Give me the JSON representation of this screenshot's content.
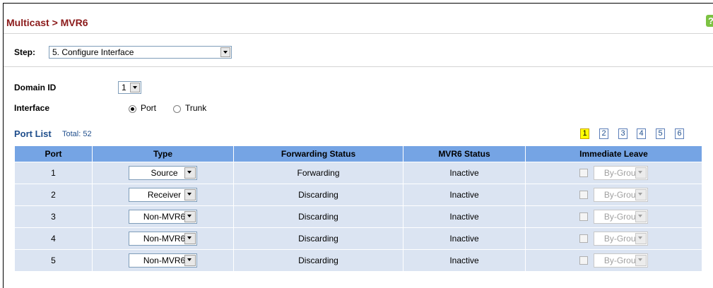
{
  "header": {
    "title": "Multicast > MVR6",
    "help_icon": "question-icon"
  },
  "step": {
    "label": "Step:",
    "value": "5. Configure Interface"
  },
  "form": {
    "domain_label": "Domain ID",
    "domain_value": "1",
    "interface_label": "Interface",
    "interface_options": [
      {
        "label": "Port",
        "checked": true
      },
      {
        "label": "Trunk",
        "checked": false
      }
    ]
  },
  "portlist": {
    "title": "Port List",
    "total": "Total: 52",
    "pages": [
      "1",
      "2",
      "3",
      "4",
      "5",
      "6"
    ],
    "active_page": "1"
  },
  "table": {
    "headers": [
      "Port",
      "Type",
      "Forwarding Status",
      "MVR6 Status",
      "Immediate Leave"
    ],
    "rows": [
      {
        "port": "1",
        "type": "Source",
        "forwarding": "Forwarding",
        "mvr6": "Inactive",
        "leave": "By-Group"
      },
      {
        "port": "2",
        "type": "Receiver",
        "forwarding": "Discarding",
        "mvr6": "Inactive",
        "leave": "By-Group"
      },
      {
        "port": "3",
        "type": "Non-MVR6",
        "forwarding": "Discarding",
        "mvr6": "Inactive",
        "leave": "By-Group"
      },
      {
        "port": "4",
        "type": "Non-MVR6",
        "forwarding": "Discarding",
        "mvr6": "Inactive",
        "leave": "By-Group"
      },
      {
        "port": "5",
        "type": "Non-MVR6",
        "forwarding": "Discarding",
        "mvr6": "Inactive",
        "leave": "By-Group"
      }
    ]
  },
  "colors": {
    "title": "#8b1a1a",
    "header_bg": "#75a4e4",
    "row_bg": "#dbe4f2",
    "link": "#1f4e8c",
    "active_page": "#ffff00"
  }
}
